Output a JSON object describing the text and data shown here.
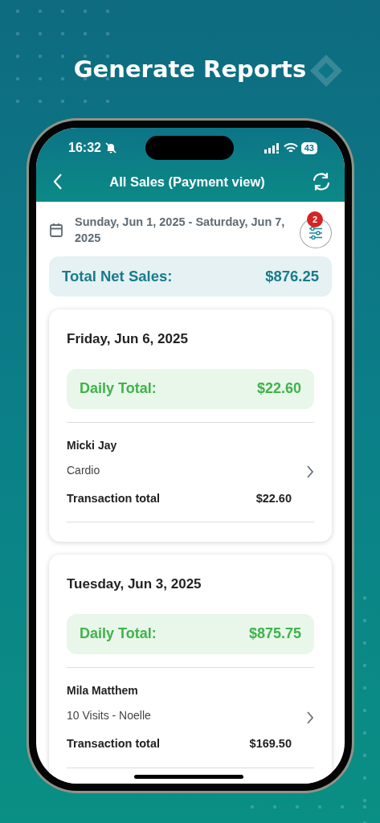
{
  "headline": "Generate Reports",
  "status_bar": {
    "time": "16:32",
    "battery": "43"
  },
  "header": {
    "title": "All Sales (Payment view)"
  },
  "date_range": "Sunday, Jun 1, 2025 - Saturday, Jun 7, 2025",
  "filter": {
    "badge": "2"
  },
  "total": {
    "label": "Total Net Sales:",
    "value": "$876.25"
  },
  "days": [
    {
      "date": "Friday, Jun 6, 2025",
      "daily_label": "Daily Total:",
      "daily_value": "$22.60",
      "transactions": [
        {
          "name": "Micki Jay",
          "description": "Cardio",
          "total_label": "Transaction total",
          "total": "$22.60"
        }
      ]
    },
    {
      "date": "Tuesday, Jun 3, 2025",
      "daily_label": "Daily Total:",
      "daily_value": "$875.75",
      "transactions": [
        {
          "name": "Mila Matthem",
          "description": "10 Visits - Noelle",
          "total_label": "Transaction total",
          "total": "$169.50"
        }
      ]
    }
  ]
}
